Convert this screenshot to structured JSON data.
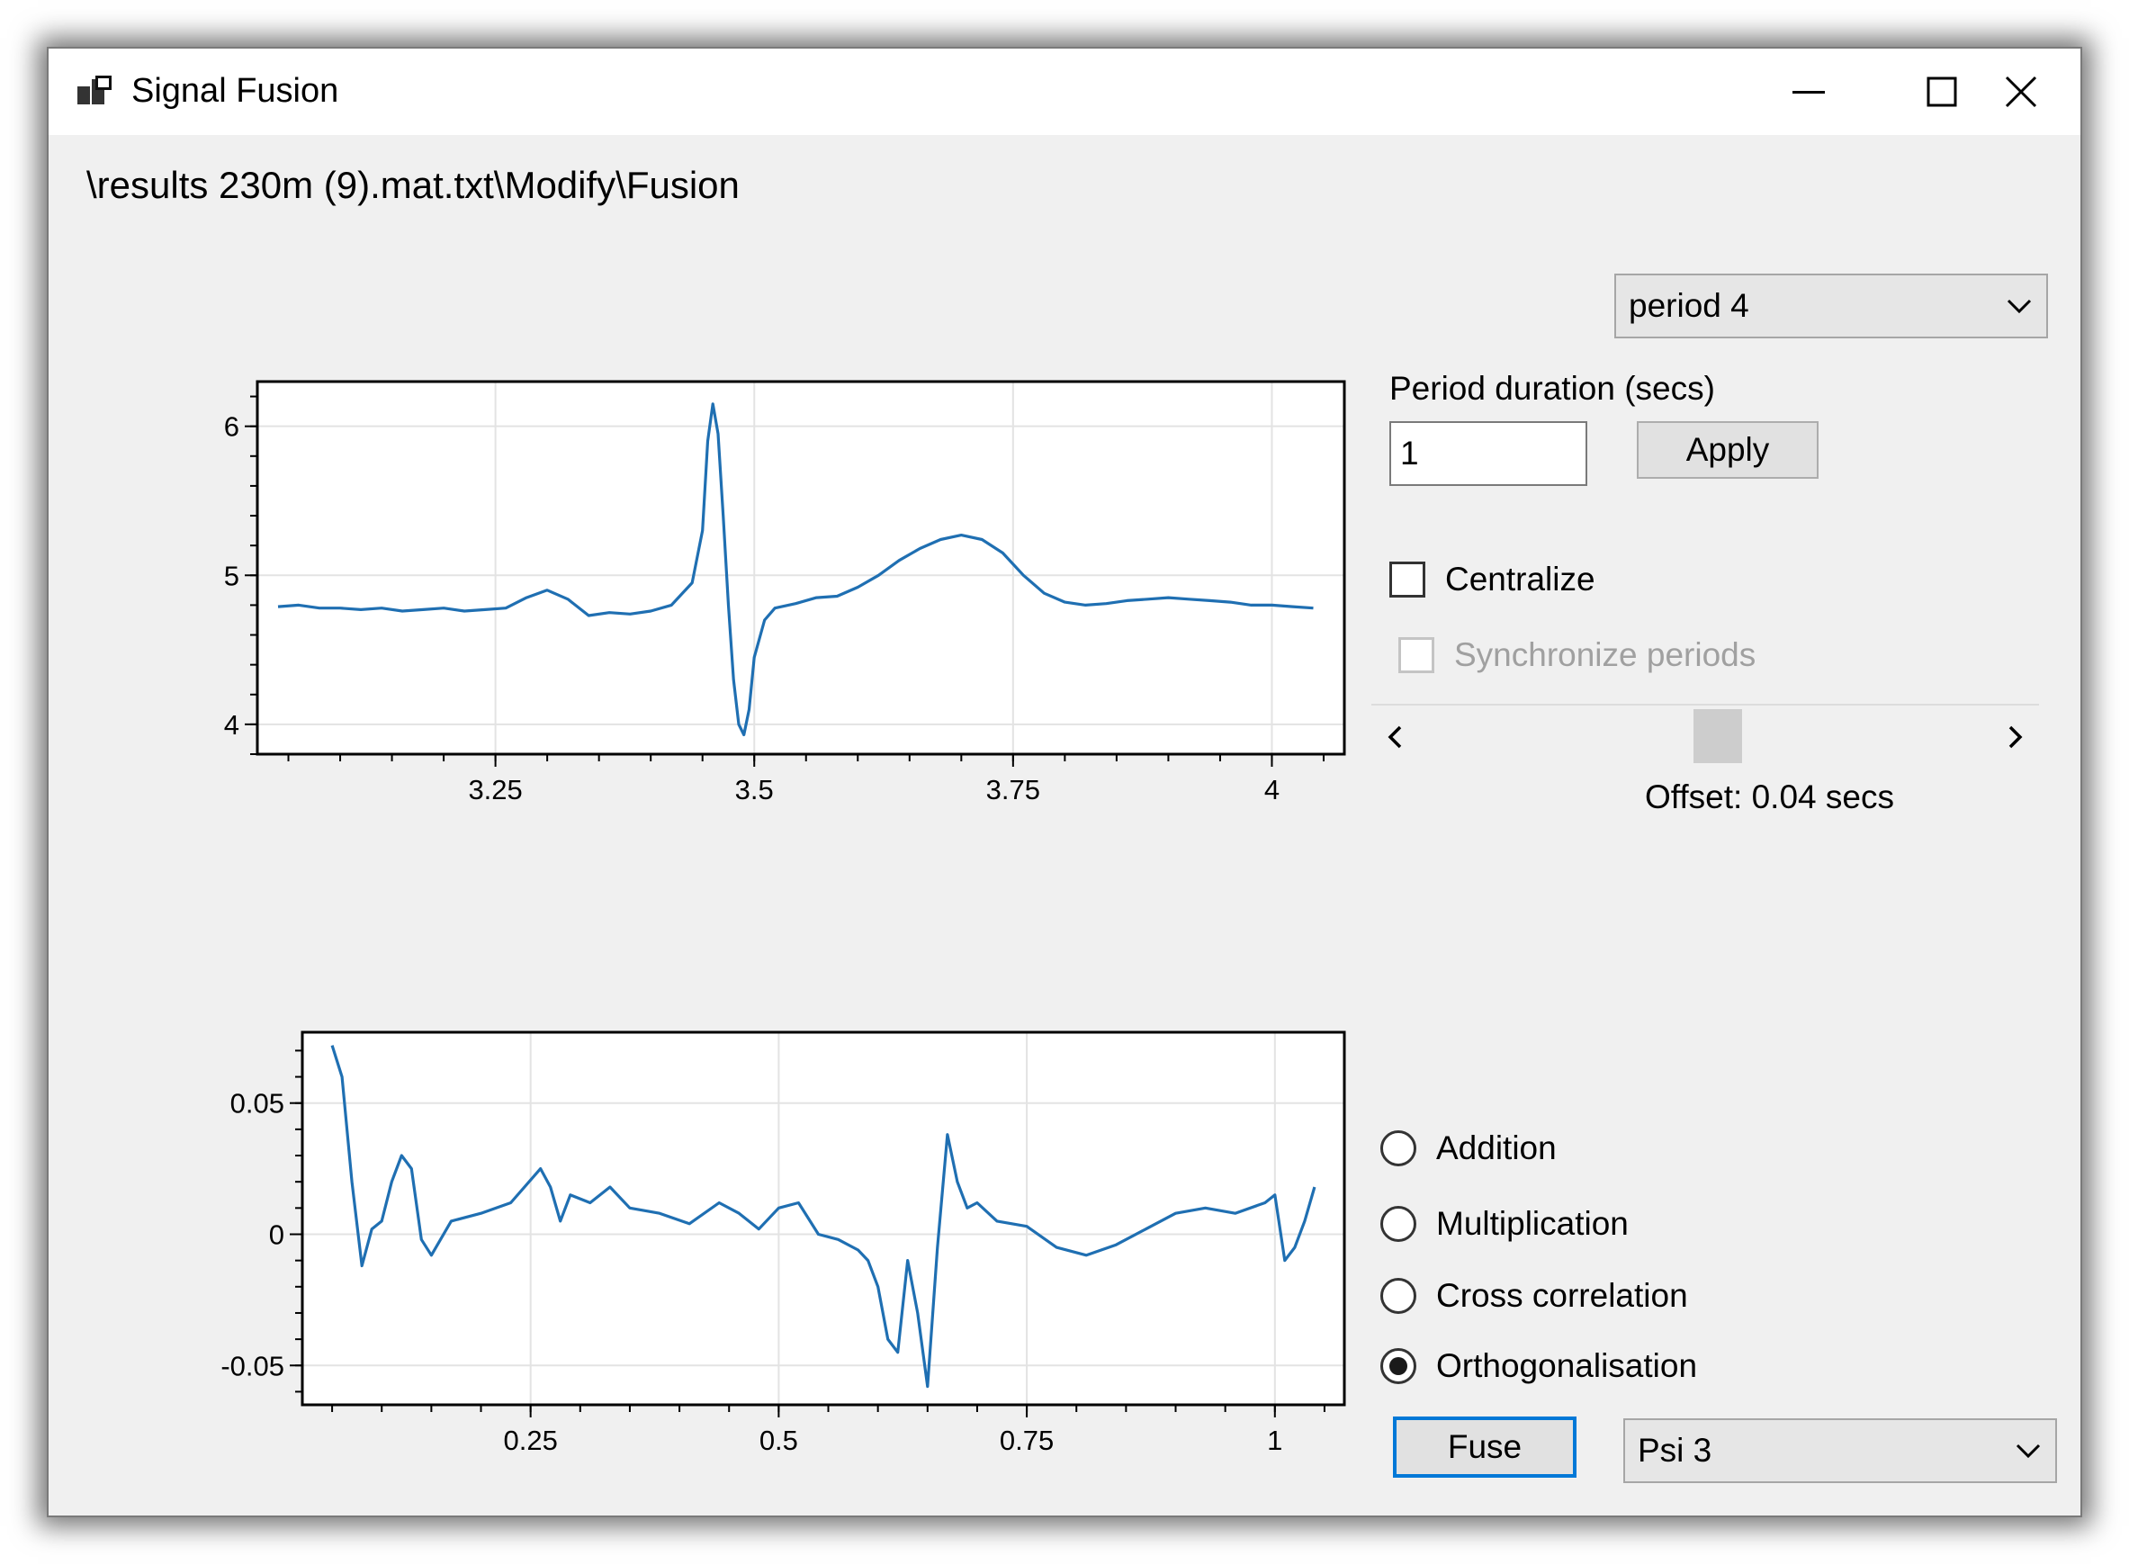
{
  "window": {
    "title": "Signal Fusion",
    "controls": {
      "minimize": "minimize-icon",
      "maximize": "maximize-icon",
      "close": "close-icon"
    }
  },
  "path": "\\results 230m (9).mat.txt\\Modify\\Fusion",
  "period_select": {
    "value": "period 4"
  },
  "period_duration": {
    "label": "Period duration (secs)",
    "value": "1",
    "apply_label": "Apply"
  },
  "centralize": {
    "label": "Centralize",
    "checked": false
  },
  "synchronize": {
    "label": "Synchronize periods",
    "checked": false,
    "enabled": false
  },
  "offset": {
    "label": "Offset: 0.04 secs"
  },
  "operations": [
    {
      "label": "Addition",
      "selected": false
    },
    {
      "label": "Multiplication",
      "selected": false
    },
    {
      "label": "Cross correlation",
      "selected": false
    },
    {
      "label": "Orthogonalisation",
      "selected": true
    }
  ],
  "fuse": {
    "label": "Fuse"
  },
  "wavelet_select": {
    "value": "Psi 3"
  },
  "colors": {
    "series": "#1f6fb2",
    "window_bg": "#f0f0f0",
    "grid": "#e3e3e3",
    "accent": "#0078d7"
  },
  "chart_data": [
    {
      "type": "line",
      "title": "",
      "xlabel": "",
      "ylabel": "",
      "xlim": [
        3.02,
        4.07
      ],
      "ylim": [
        3.8,
        6.3
      ],
      "x_ticks": [
        3.25,
        3.5,
        3.75,
        4
      ],
      "x_tick_labels": [
        "3.25",
        "3.5",
        "3.75",
        "4"
      ],
      "y_ticks": [
        4,
        5,
        6
      ],
      "y_tick_labels": [
        "4",
        "5",
        "6"
      ],
      "grid": true,
      "series": [
        {
          "x": [
            3.04,
            3.06,
            3.08,
            3.1,
            3.12,
            3.14,
            3.16,
            3.18,
            3.2,
            3.22,
            3.24,
            3.26,
            3.28,
            3.3,
            3.32,
            3.34,
            3.36,
            3.38,
            3.4,
            3.42,
            3.44,
            3.45,
            3.455,
            3.46,
            3.465,
            3.47,
            3.475,
            3.48,
            3.485,
            3.49,
            3.495,
            3.5,
            3.51,
            3.52,
            3.54,
            3.56,
            3.58,
            3.6,
            3.62,
            3.64,
            3.66,
            3.68,
            3.7,
            3.72,
            3.74,
            3.76,
            3.78,
            3.8,
            3.82,
            3.84,
            3.86,
            3.88,
            3.9,
            3.92,
            3.94,
            3.96,
            3.98,
            4.0,
            4.02,
            4.04
          ],
          "y": [
            4.79,
            4.8,
            4.78,
            4.78,
            4.77,
            4.78,
            4.76,
            4.77,
            4.78,
            4.76,
            4.77,
            4.78,
            4.85,
            4.9,
            4.84,
            4.73,
            4.75,
            4.74,
            4.76,
            4.8,
            4.95,
            5.3,
            5.9,
            6.15,
            5.95,
            5.4,
            4.8,
            4.3,
            4.0,
            3.93,
            4.1,
            4.45,
            4.7,
            4.78,
            4.81,
            4.85,
            4.86,
            4.92,
            5.0,
            5.1,
            5.18,
            5.24,
            5.27,
            5.24,
            5.15,
            5.0,
            4.88,
            4.82,
            4.8,
            4.81,
            4.83,
            4.84,
            4.85,
            4.84,
            4.83,
            4.82,
            4.8,
            4.8,
            4.79,
            4.78
          ]
        }
      ]
    },
    {
      "type": "line",
      "title": "",
      "xlabel": "",
      "ylabel": "",
      "xlim": [
        0.02,
        1.07
      ],
      "ylim": [
        -0.065,
        0.077
      ],
      "x_ticks": [
        0.25,
        0.5,
        0.75,
        1
      ],
      "x_tick_labels": [
        "0.25",
        "0.5",
        "0.75",
        "1"
      ],
      "y_ticks": [
        -0.05,
        0,
        0.05
      ],
      "y_tick_labels": [
        "-0.05",
        "0",
        "0.05"
      ],
      "grid": true,
      "series": [
        {
          "x": [
            0.05,
            0.06,
            0.07,
            0.08,
            0.09,
            0.1,
            0.11,
            0.12,
            0.13,
            0.14,
            0.15,
            0.17,
            0.2,
            0.23,
            0.26,
            0.27,
            0.28,
            0.29,
            0.31,
            0.33,
            0.35,
            0.38,
            0.41,
            0.44,
            0.46,
            0.48,
            0.5,
            0.52,
            0.54,
            0.56,
            0.58,
            0.59,
            0.6,
            0.61,
            0.62,
            0.63,
            0.64,
            0.65,
            0.66,
            0.67,
            0.68,
            0.69,
            0.7,
            0.72,
            0.75,
            0.78,
            0.81,
            0.84,
            0.87,
            0.9,
            0.93,
            0.96,
            0.99,
            1.0,
            1.01,
            1.02,
            1.03,
            1.04
          ],
          "y": [
            0.072,
            0.06,
            0.02,
            -0.012,
            0.002,
            0.005,
            0.02,
            0.03,
            0.025,
            -0.002,
            -0.008,
            0.005,
            0.008,
            0.012,
            0.025,
            0.018,
            0.005,
            0.015,
            0.012,
            0.018,
            0.01,
            0.008,
            0.004,
            0.012,
            0.008,
            0.002,
            0.01,
            0.012,
            0.0,
            -0.002,
            -0.006,
            -0.01,
            -0.02,
            -0.04,
            -0.045,
            -0.01,
            -0.03,
            -0.058,
            -0.005,
            0.038,
            0.02,
            0.01,
            0.012,
            0.005,
            0.003,
            -0.005,
            -0.008,
            -0.004,
            0.002,
            0.008,
            0.01,
            0.008,
            0.012,
            0.015,
            -0.01,
            -0.005,
            0.005,
            0.018
          ]
        }
      ]
    }
  ]
}
